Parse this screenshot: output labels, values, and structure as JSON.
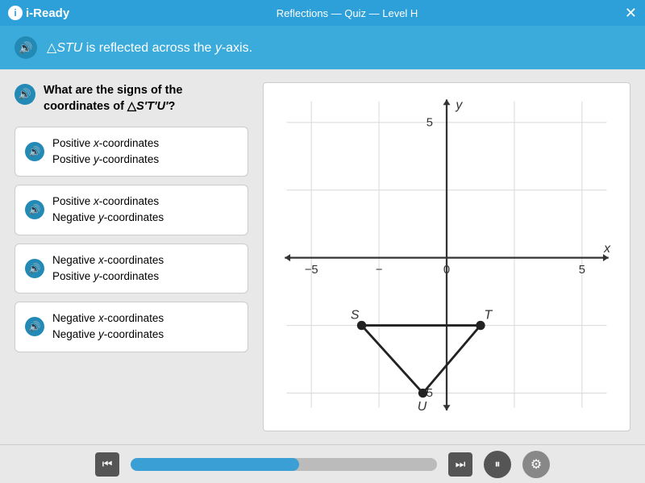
{
  "titlebar": {
    "logo": "i-Ready",
    "title": "Reflections — Quiz — Level H",
    "close": "✕"
  },
  "banner": {
    "text": "△STU is reflected across the y-axis."
  },
  "question": {
    "text": "What are the signs of the coordinates of △S′T′U′?"
  },
  "options": [
    {
      "line1": "Positive x-coordinates",
      "line2": "Positive y-coordinates"
    },
    {
      "line1": "Positive x-coordinates",
      "line2": "Negative y-coordinates"
    },
    {
      "line1": "Negative x-coordinates",
      "line2": "Positive y-coordinates"
    },
    {
      "line1": "Negative x-coordinates",
      "line2": "Negative y-coordinates"
    }
  ],
  "graph": {
    "xLabel": "x",
    "yLabel": "y",
    "xMin": -5,
    "xMax": 5,
    "yMin": -5,
    "yMax": 5,
    "points": {
      "S": {
        "x": -2.5,
        "y": -2
      },
      "T": {
        "x": 1,
        "y": -2
      },
      "U": {
        "x": -0.7,
        "y": -4
      }
    }
  },
  "progress": {
    "percent": 55
  },
  "speaker_icon": "🔊",
  "pause_icon": "⏸",
  "settings_icon": "⚙",
  "prev_icon": "⏮",
  "next_icon": "⏭"
}
